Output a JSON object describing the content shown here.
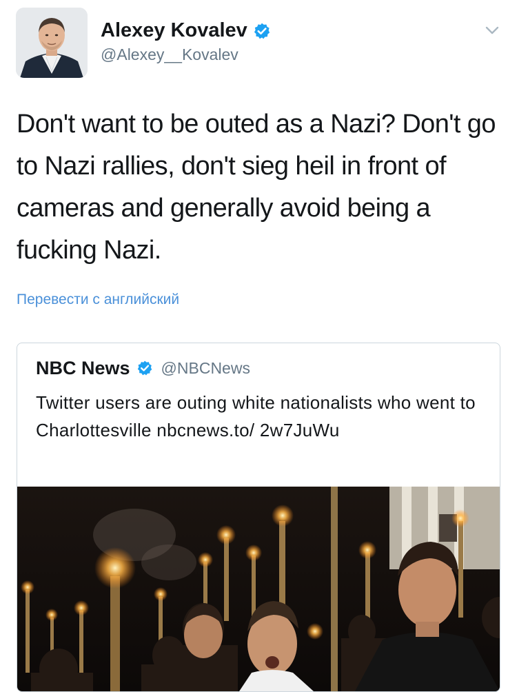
{
  "tweet": {
    "author": {
      "name": "Alexey Kovalev",
      "handle": "@Alexey__Kovalev",
      "verified": true,
      "avatar": "profile-photo"
    },
    "text": "Don't want to be outed as a Nazi? Don't go to Nazi rallies, don't sieg heil in front of cameras and generally avoid being a fucking Nazi.",
    "translate_label": "Перевести с английский",
    "menu_icon": "chevron-down-icon"
  },
  "quoted_tweet": {
    "name": "NBC News",
    "handle": "@NBCNews",
    "verified": true,
    "text": "Twitter users are outing white nationalists who went to Charlottesville nbcnews.to/ 2w7JuWu",
    "image": "night-torch-rally-photo"
  },
  "colors": {
    "text_primary": "#14171a",
    "text_secondary": "#657786",
    "link": "#4a90d9",
    "verified_badge": "#1da1f2",
    "card_border": "#ccd6dd"
  }
}
